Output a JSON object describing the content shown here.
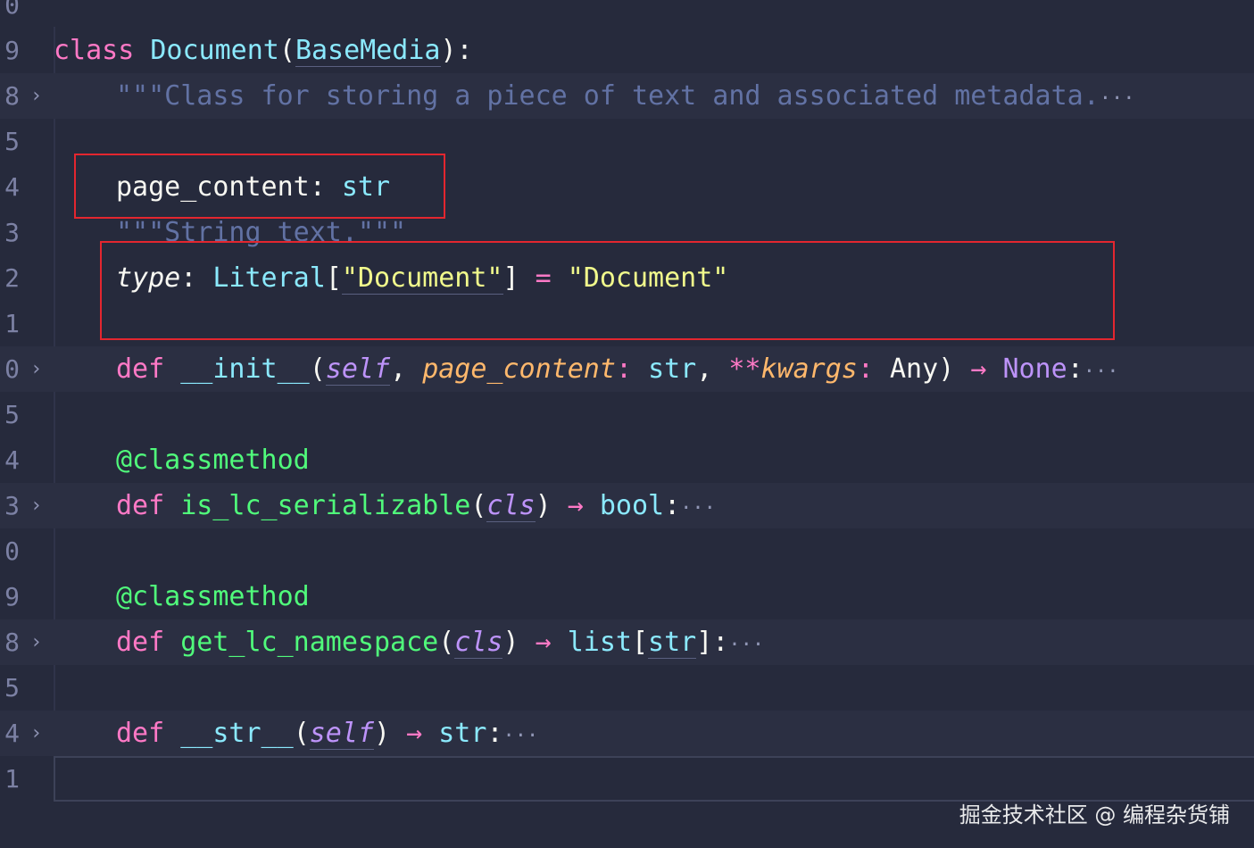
{
  "gutter": {
    "line_numbers": [
      "0",
      "9",
      "8",
      "5",
      "4",
      "3",
      "2",
      "1",
      "0",
      "5",
      "4",
      "3",
      "0",
      "9",
      "8",
      "5",
      "4",
      "1"
    ],
    "fold_glyph": "›",
    "ellipsis": "···"
  },
  "code": {
    "class_kw": "class",
    "class_name": "Document",
    "base_class": "BaseMedia",
    "class_tail": "):",
    "docstring": "\"\"\"Class for storing a piece of text and associated metadata.",
    "attr_page_content": "page_content",
    "attr_page_content_type": "str",
    "attr_docstring": "\"\"\"String text.\"\"\"",
    "attr_type": "type",
    "literal": "Literal",
    "literal_arg": "\"Document\"",
    "type_default": "\"Document\"",
    "def_kw": "def",
    "init_name": "__init__",
    "self_kw": "self",
    "param_page_content": "page_content",
    "param_type_str": "str",
    "kwargs_op": "**",
    "kwargs_name": "kwargs",
    "kwargs_type": "Any",
    "arrow": "→",
    "none_kw": "None",
    "decorator": "@classmethod",
    "fn_is_serializable": "is_lc_serializable",
    "cls_kw": "cls",
    "bool_type": "bool",
    "fn_get_namespace": "get_lc_namespace",
    "list_type": "list",
    "str_name": "__str__",
    "str_type": "str"
  },
  "watermark": "掘金技术社区 @ 编程杂货铺",
  "colors": {
    "background": "#262a3c",
    "keyword": "#ff79c6",
    "class_name": "#8be9fd",
    "function": "#50fa7b",
    "string": "#f1fa8c",
    "comment": "#6272a4",
    "parameter": "#ffb86c",
    "self": "#bd93f9",
    "highlight_box": "#e3262f"
  }
}
